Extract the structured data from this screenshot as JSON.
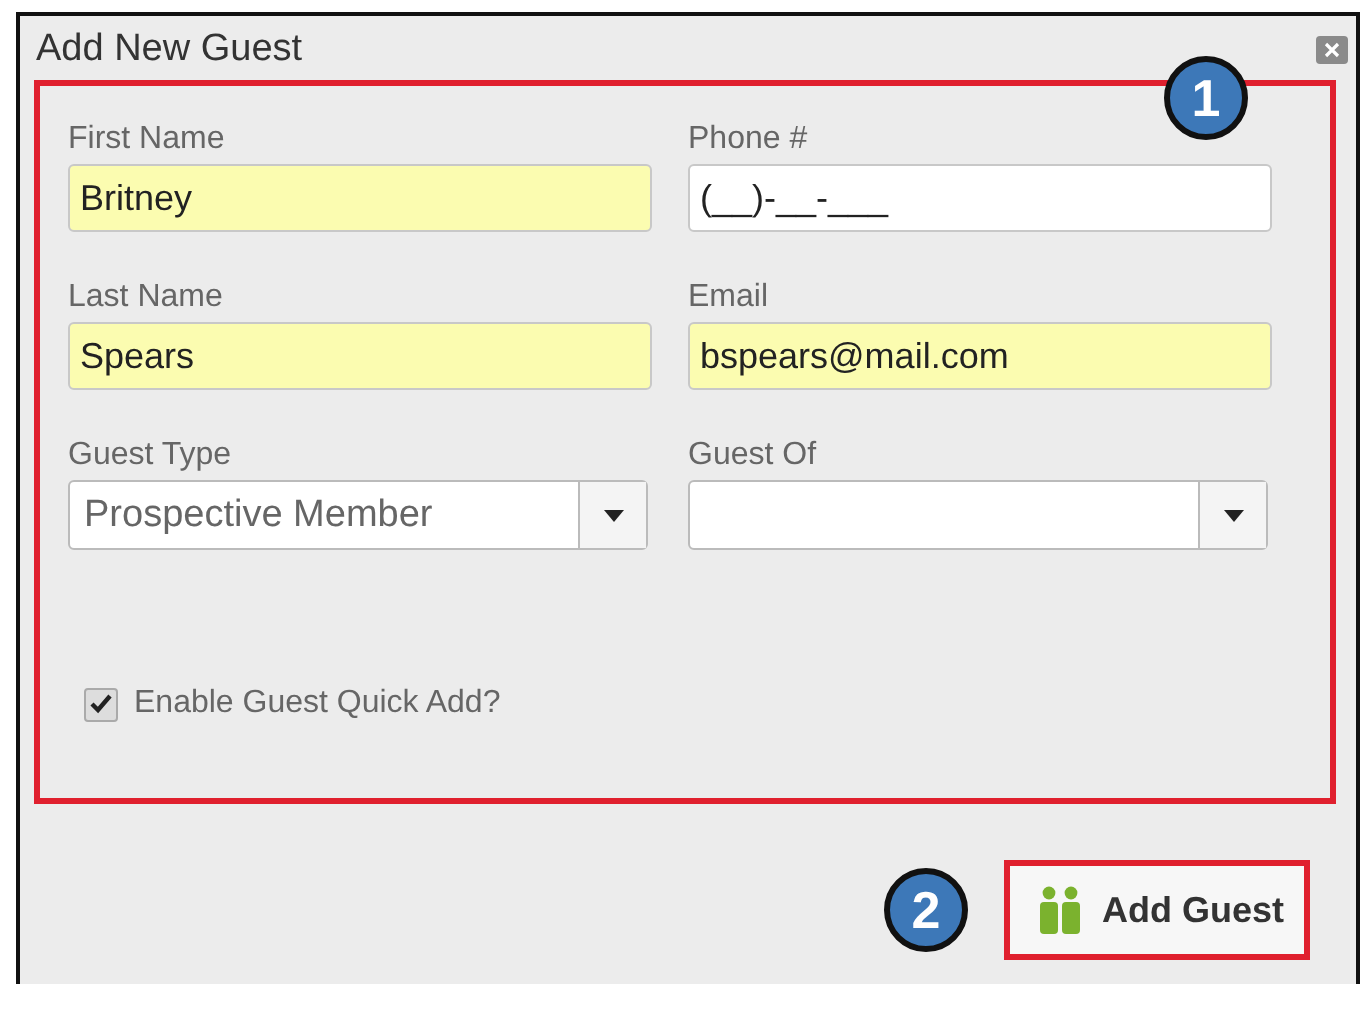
{
  "window": {
    "title": "Add New Guest"
  },
  "fields": [
    {
      "kind": "text",
      "label": "First Name",
      "value": "Britney",
      "highlighted": true
    },
    {
      "kind": "text",
      "label": "Phone #",
      "value": "(__)-__-___",
      "highlighted": false
    },
    {
      "kind": "text",
      "label": "Last Name",
      "value": "Spears",
      "highlighted": true
    },
    {
      "kind": "text",
      "label": "Email",
      "value": "bspears@mail.com",
      "highlighted": true
    },
    {
      "kind": "select",
      "label": "Guest Type",
      "value": "Prospective Member",
      "highlighted": false
    },
    {
      "kind": "select",
      "label": "Guest Of",
      "highlighted": false
    }
  ],
  "quick_add": {
    "label": "Enable Guest Quick Add?",
    "checked": true
  },
  "add_button": {
    "label": "Add Guest"
  },
  "callouts": [
    "1",
    "2"
  ]
}
